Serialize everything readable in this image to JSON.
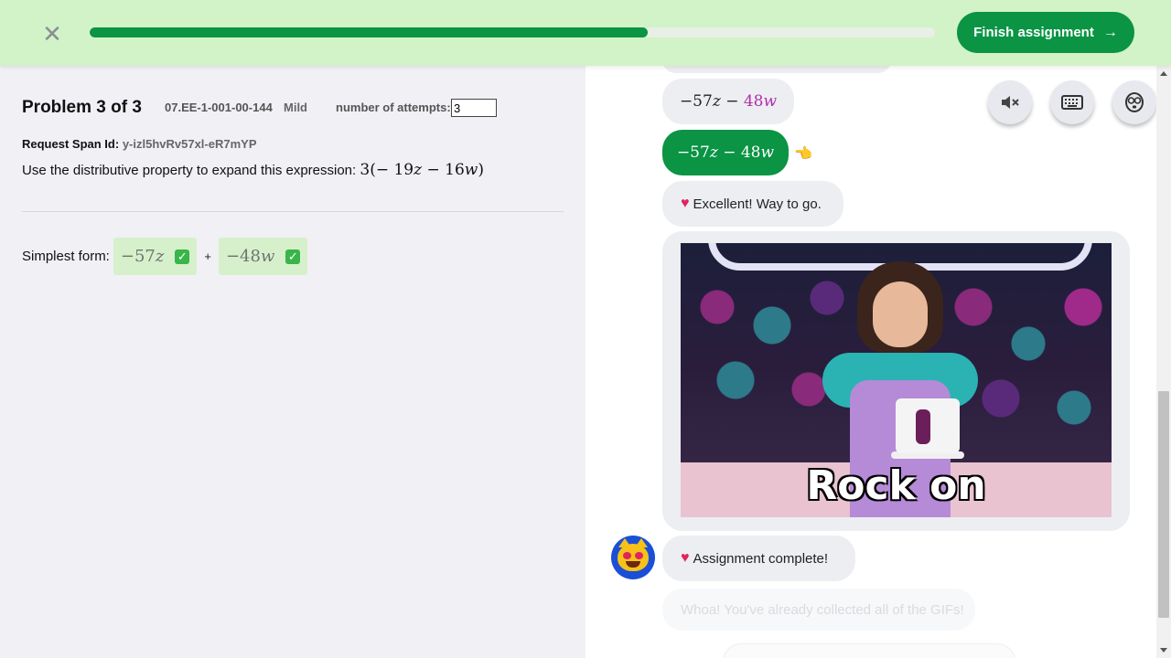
{
  "header": {
    "close_icon": "close-icon",
    "progress": 0.66,
    "finish_label": "Finish assignment",
    "finish_arrow": "→",
    "accent": "#0a9444",
    "bg": "#d2f2c7"
  },
  "problem": {
    "title": "Problem 3 of 3",
    "code": "07.EE-1-001-00-144",
    "level": "Mild",
    "attempts_label": "number of attempts:",
    "attempts_value": "3",
    "span_label": "Request Span Id:",
    "span_value": "y-izl5hvRv57xl-eR7mYP",
    "instructions": "Use the distributive property to expand this expression:",
    "expression": {
      "coef": "3",
      "open": "(",
      "t1": "− 19",
      "v1": "z",
      "minus": " − 16",
      "v2": "w",
      "close": ")"
    },
    "simplest_label": "Simplest form:",
    "answer1": {
      "num": "−57",
      "var": "z"
    },
    "plus": "+",
    "answer2": {
      "num": "−48",
      "var": "w"
    },
    "check": "✓"
  },
  "chat": {
    "option1": {
      "num": "−57",
      "var": "z",
      "op": " − ",
      "num2": "48",
      "var2": "w"
    },
    "option2": {
      "num": "−57",
      "var": "z",
      "op": " − ",
      "num2": "48",
      "var2": "w"
    },
    "pointer": "👈",
    "excellent": "Excellent! Way to go.",
    "gif_caption": "Rock on",
    "complete": "Assignment complete!",
    "ghost": "Whoa! You've already collected all of the GIFs!"
  },
  "tools": {
    "mute_icon": "mute-icon",
    "keyboard_icon": "keyboard-icon",
    "mascot_icon": "mascot-icon"
  }
}
